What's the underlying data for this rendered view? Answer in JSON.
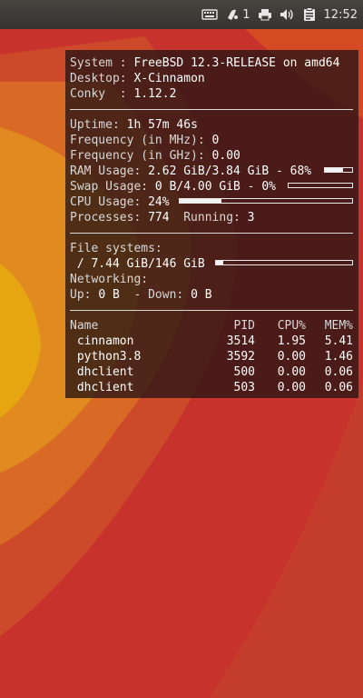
{
  "panel": {
    "clock": "12:52",
    "notification_count": "1",
    "tray_icons": [
      "keyboard-icon",
      "notification-icon",
      "printer-icon",
      "volume-icon",
      "clipboard-icon"
    ]
  },
  "conky": {
    "system_label": "System : ",
    "system_value": "FreeBSD 12.3-RELEASE on amd64",
    "desktop_label": "Desktop: ",
    "desktop_value": "X-Cinnamon",
    "conky_label": "Conky  : ",
    "conky_value": "1.12.2",
    "uptime_label": "Uptime: ",
    "uptime_value": "1h 57m 46s",
    "freq_mhz_label": "Frequency (in MHz): ",
    "freq_mhz_value": "0",
    "freq_ghz_label": "Frequency (in GHz): ",
    "freq_ghz_value": "0.00",
    "ram_label": "RAM Usage: ",
    "ram_value": "2.62 GiB/3.84 GiB - 68%",
    "ram_fraction": 0.68,
    "swap_label": "Swap Usage: ",
    "swap_value": "0 B/4.00 GiB - 0%",
    "swap_fraction": 0.0,
    "cpu_label": "CPU Usage: ",
    "cpu_value": "24%",
    "cpu_fraction": 0.24,
    "processes_label": "Processes: ",
    "processes_value": "774",
    "running_label": "  Running: ",
    "running_value": "3",
    "fs_label": "File systems:",
    "fs_line_prefix": " / ",
    "fs_value": "7.44 GiB/146 GiB",
    "fs_fraction": 0.05,
    "net_label": "Networking:",
    "net_up_label": "Up: ",
    "net_up_value": "0 B",
    "net_down_label": "  - Down: ",
    "net_down_value": "0 B",
    "proc_headers": [
      "Name",
      "PID",
      "CPU%",
      "MEM%"
    ],
    "processes": [
      {
        "name": " cinnamon",
        "pid": "3514",
        "cpu": "1.95",
        "mem": "5.41"
      },
      {
        "name": " python3.8",
        "pid": "3592",
        "cpu": "0.00",
        "mem": "1.46"
      },
      {
        "name": " dhclient",
        "pid": "500",
        "cpu": "0.00",
        "mem": "0.06"
      },
      {
        "name": " dhclient",
        "pid": "503",
        "cpu": "0.00",
        "mem": "0.06"
      }
    ]
  }
}
